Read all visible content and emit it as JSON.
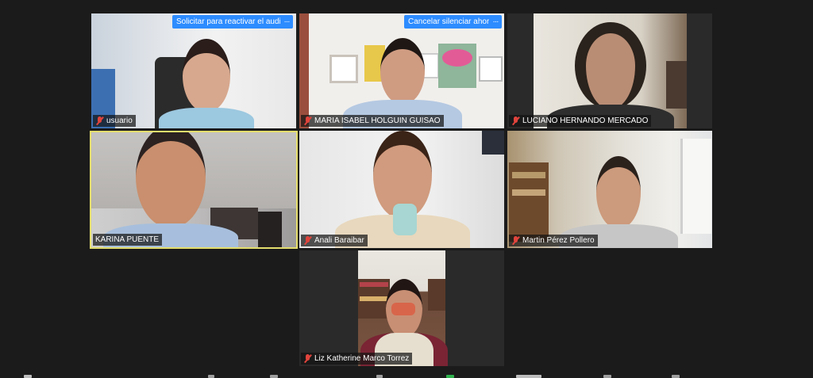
{
  "participants": [
    {
      "name": "usuario",
      "muted": true,
      "action": "Solicitar para reactivar el audio"
    },
    {
      "name": "MARIA ISABEL HOLGUIN GUISAO",
      "muted": true,
      "action": "Cancelar silenciar ahora"
    },
    {
      "name": "LUCIANO HERNANDO MERCADO",
      "muted": true
    },
    {
      "name": "KARINA PUENTE",
      "muted": false,
      "active_speaker": true
    },
    {
      "name": "Anali Baraibar",
      "muted": true
    },
    {
      "name": "Martin Pérez Pollero",
      "muted": true
    },
    {
      "name": "Liz Katherine Marco Torrez",
      "muted": true
    }
  ],
  "more_label": "···",
  "colors": {
    "speaker_border": "#e4dd6c",
    "action_blue": "#2d8cff",
    "muted_red": "#e0443c",
    "background": "#1b1b1b"
  }
}
